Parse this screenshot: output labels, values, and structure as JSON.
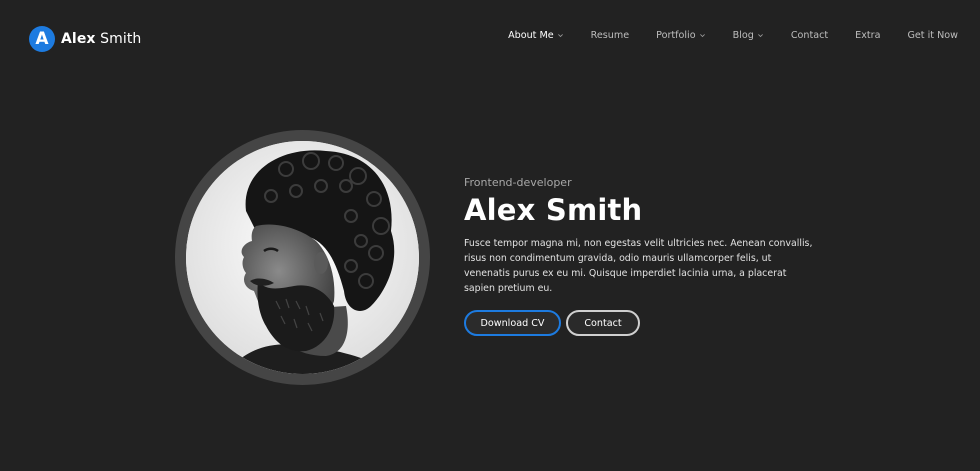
{
  "brand": {
    "logo_letter": "A",
    "first_name": "Alex",
    "last_name": "Smith",
    "accent_color": "#1d7be0"
  },
  "nav": {
    "items": [
      {
        "label": "About Me",
        "active": true,
        "dropdown": true
      },
      {
        "label": "Resume",
        "active": false,
        "dropdown": false
      },
      {
        "label": "Portfolio",
        "active": false,
        "dropdown": true
      },
      {
        "label": "Blog",
        "active": false,
        "dropdown": true
      },
      {
        "label": "Contact",
        "active": false,
        "dropdown": false
      },
      {
        "label": "Extra",
        "active": false,
        "dropdown": false
      },
      {
        "label": "Get it Now",
        "active": false,
        "dropdown": false
      }
    ]
  },
  "hero": {
    "subtitle": "Frontend-developer",
    "name": "Alex Smith",
    "bio": "Fusce tempor magna mi, non egestas velit ultricies nec. Aenean convallis, risus non condimentum gravida, odio mauris ullamcorper felis, ut venenatis purus ex eu mi. Quisque imperdiet lacinia urna, a placerat sapien pretium eu.",
    "download_cv_label": "Download CV",
    "contact_label": "Contact"
  },
  "avatar": {
    "icon": "portrait-photo"
  }
}
